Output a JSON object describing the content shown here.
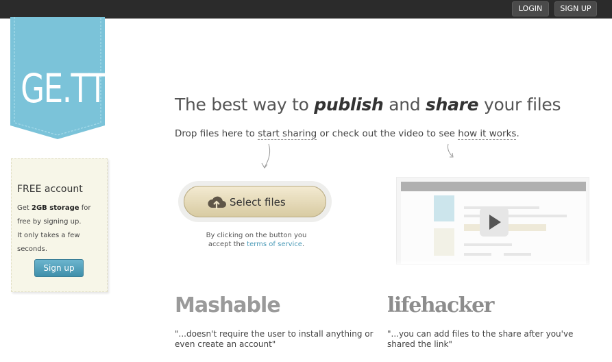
{
  "topbar": {
    "login_label": "LOGIN",
    "signup_label": "SIGN UP"
  },
  "logo": {
    "text": "GE.TT"
  },
  "free_account": {
    "title": "FREE account",
    "line1_pre": "Get ",
    "line1_bold": "2GB storage",
    "line1_post": " for free by signing up.",
    "line2": "It only takes a few seconds.",
    "button_label": "Sign up"
  },
  "headline": {
    "part1": "The best way to ",
    "em1": "publish",
    "part2": " and ",
    "em2": "share",
    "part3": " your files"
  },
  "subline": {
    "part1": "Drop files here to ",
    "link1": "start sharing",
    "part2": " or check out the video to see ",
    "link2": "how it works",
    "part3": "."
  },
  "select": {
    "label": "Select files"
  },
  "terms": {
    "line1": "By clicking on the button you",
    "pre": "accept the ",
    "link": "terms of service",
    "post": "."
  },
  "testimonials": [
    {
      "brand": "Mashable",
      "quote": "\"...doesn't require the user to install anything or even create an account\""
    },
    {
      "brand": "lifehacker",
      "quote": "\"...you can add files to the share after you've shared the link\""
    }
  ],
  "colors": {
    "topbar": "#2b2b2b",
    "logo_blue": "#7bc3d9",
    "button_blue": "#3f8faa",
    "link": "#4a9ab7"
  }
}
